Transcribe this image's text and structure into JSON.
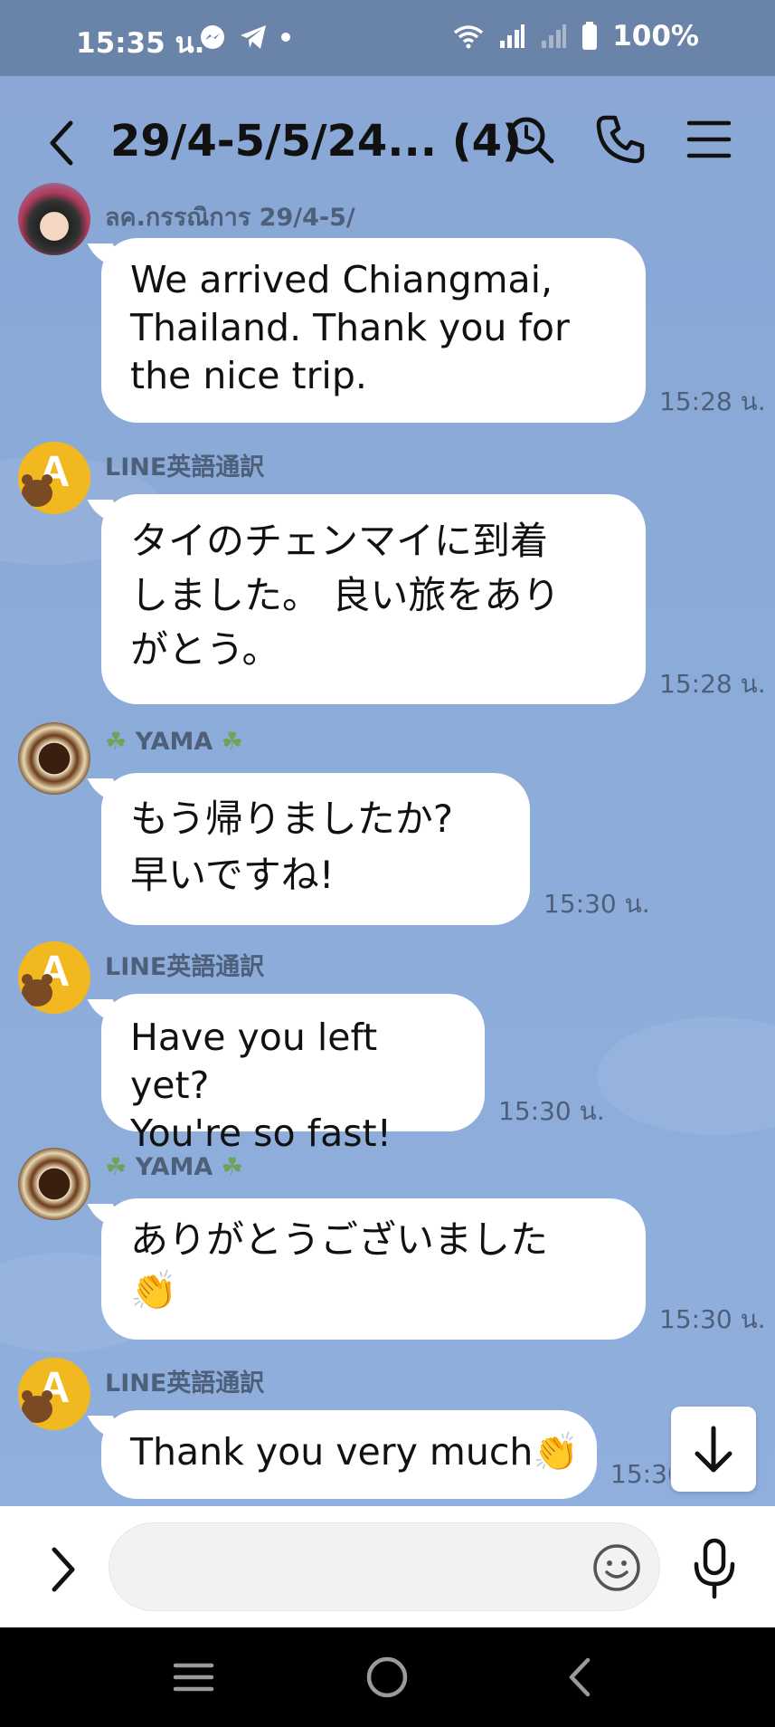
{
  "status_bar": {
    "time": "15:35 น.",
    "battery": "100%",
    "icons": [
      "messenger-icon",
      "telegram-icon",
      "dot-icon",
      "wifi-icon",
      "signal-icon",
      "signal-weak-icon",
      "battery-icon"
    ]
  },
  "header": {
    "title": "29/4-5/5/24... (4)",
    "icons": [
      "back-icon",
      "search-icon",
      "phone-icon",
      "menu-icon"
    ]
  },
  "messages": [
    {
      "sender": "ลค.กรรณิการ 29/4-5/",
      "text_lines": [
        "We arrived Chiangmai,",
        "Thailand. Thank you for",
        "the nice trip."
      ],
      "time": "15:28 น."
    },
    {
      "sender": "LINE英語通訳",
      "text_lines": [
        "タイのチェンマイに到着",
        "しました。 良い旅をあり",
        "がとう。"
      ],
      "time": "15:28 น."
    },
    {
      "sender": "YAMA",
      "text_lines": [
        "もう帰りましたか?",
        "早いですね!"
      ],
      "time": "15:30 น."
    },
    {
      "sender": "LINE英語通訳",
      "text_lines": [
        "Have you left yet?",
        "You're so fast!"
      ],
      "time": "15:30 น."
    },
    {
      "sender": "YAMA",
      "text_lines": [
        "ありがとうございました",
        "👏"
      ],
      "time": "15:30 น."
    },
    {
      "sender": "LINE英語通訳",
      "text_lines": [
        "Thank you very much👏"
      ],
      "time": "15:30"
    }
  ],
  "avatar_letter": "A",
  "sender_decoration": "☘",
  "input": {
    "placeholder": ""
  },
  "colors": {
    "status_bar": "#6a83a8",
    "chat_background": "#8babd8",
    "bubble": "#ffffff",
    "avatar_line": "#f2b81f",
    "meta_text": "#4e5f7a"
  }
}
